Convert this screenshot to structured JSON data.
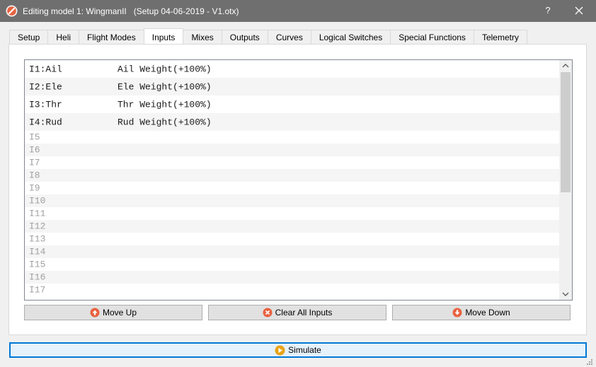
{
  "window": {
    "title": "Editing model 1: WingmanII   (Setup 04-06-2019 - V1.otx)",
    "help_glyph": "?",
    "icon": "companion-logo-icon"
  },
  "tabs": [
    {
      "label": "Setup",
      "active": false
    },
    {
      "label": "Heli",
      "active": false
    },
    {
      "label": "Flight Modes",
      "active": false
    },
    {
      "label": "Inputs",
      "active": true
    },
    {
      "label": "Mixes",
      "active": false
    },
    {
      "label": "Outputs",
      "active": false
    },
    {
      "label": "Curves",
      "active": false
    },
    {
      "label": "Logical Switches",
      "active": false
    },
    {
      "label": "Special Functions",
      "active": false
    },
    {
      "label": "Telemetry",
      "active": false
    }
  ],
  "inputs": [
    {
      "name": "I1:Ail",
      "line": "Ail Weight(+100%)"
    },
    {
      "name": "I2:Ele",
      "line": "Ele Weight(+100%)"
    },
    {
      "name": "I3:Thr",
      "line": "Thr Weight(+100%)"
    },
    {
      "name": "I4:Rud",
      "line": "Rud Weight(+100%)"
    },
    {
      "name": "I5",
      "line": ""
    },
    {
      "name": "I6",
      "line": ""
    },
    {
      "name": "I7",
      "line": ""
    },
    {
      "name": "I8",
      "line": ""
    },
    {
      "name": "I9",
      "line": ""
    },
    {
      "name": "I10",
      "line": ""
    },
    {
      "name": "I11",
      "line": ""
    },
    {
      "name": "I12",
      "line": ""
    },
    {
      "name": "I13",
      "line": ""
    },
    {
      "name": "I14",
      "line": ""
    },
    {
      "name": "I15",
      "line": ""
    },
    {
      "name": "I16",
      "line": ""
    },
    {
      "name": "I17",
      "line": ""
    }
  ],
  "buttons": {
    "move_up": "Move Up",
    "clear_all": "Clear All Inputs",
    "move_down": "Move Down",
    "simulate": "Simulate"
  },
  "colors": {
    "titlebar": "#6f6f6f",
    "accent": "#0078d7",
    "arrow_icon": "#e8623f",
    "simulate_icon": "#e8a317"
  }
}
